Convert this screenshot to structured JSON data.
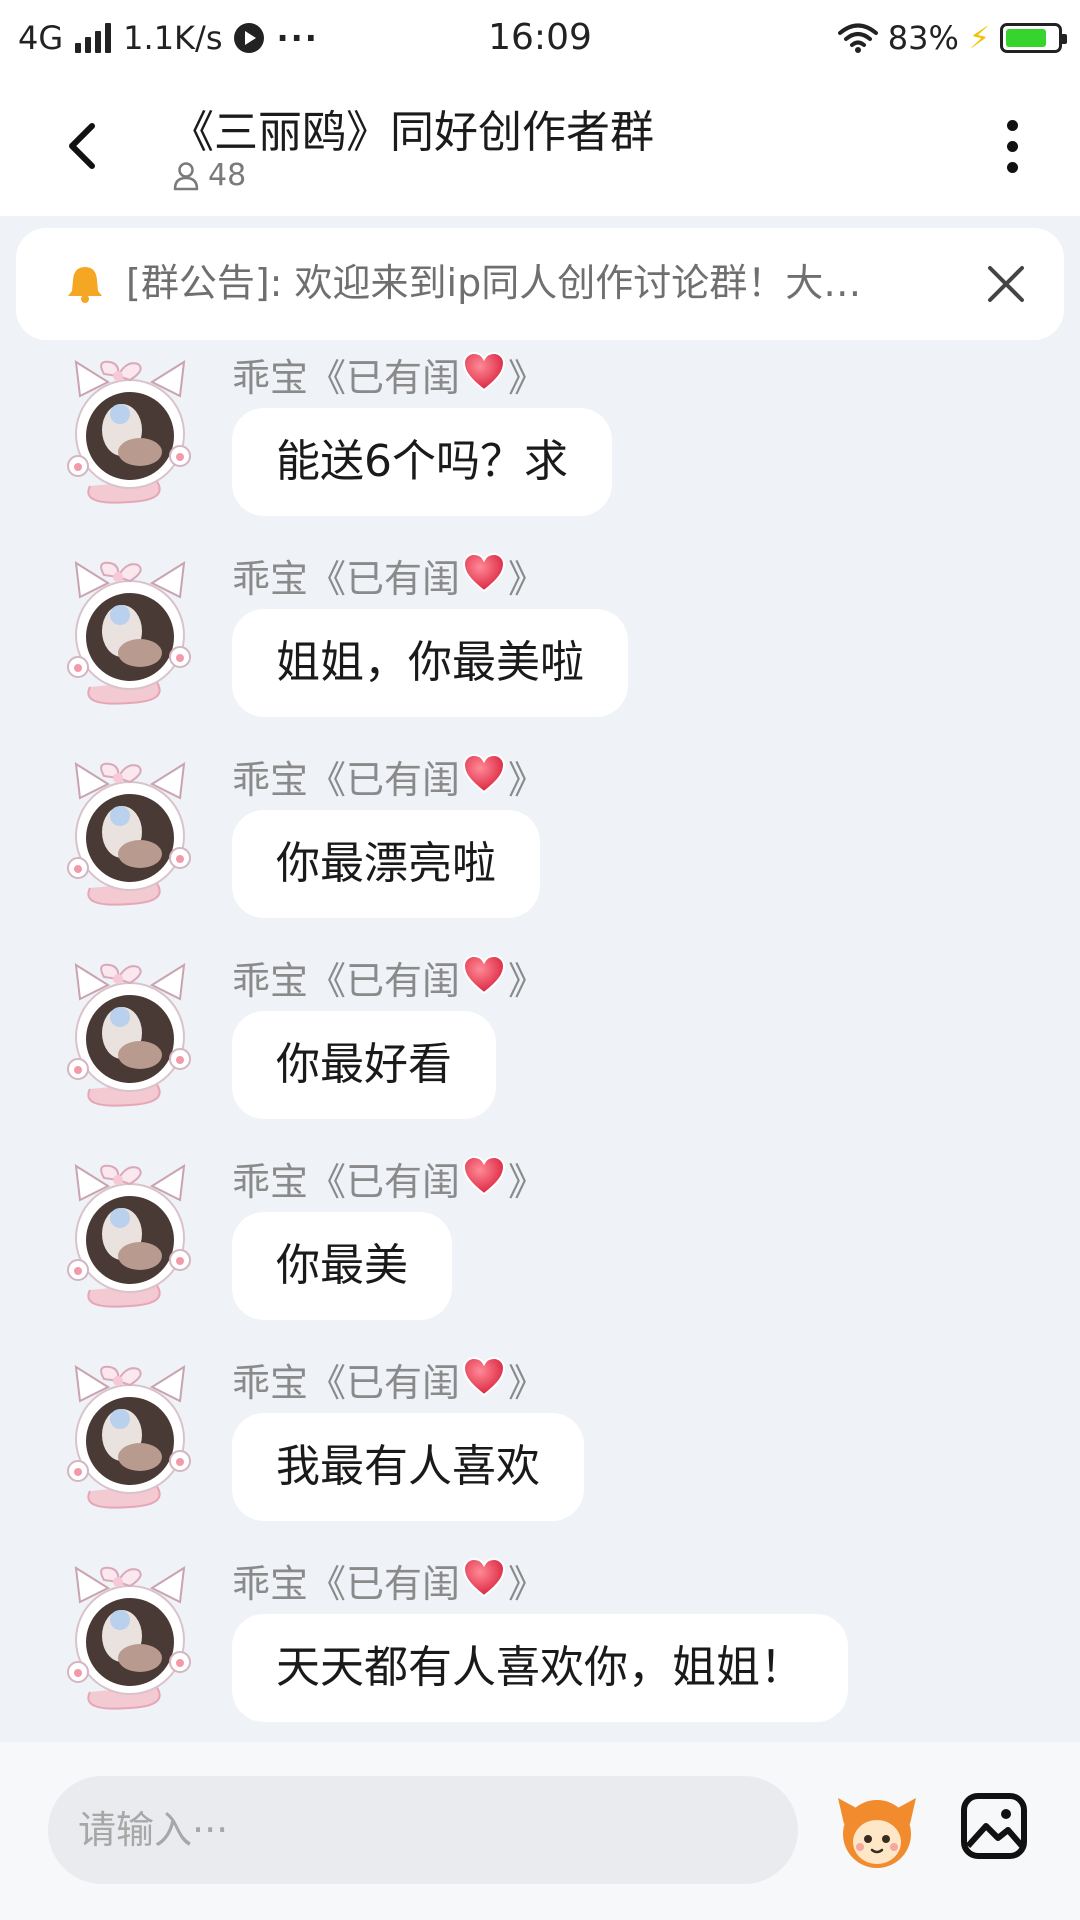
{
  "status_bar": {
    "network": "4G",
    "speed": "1.1K/s",
    "more": "···",
    "time": "16:09",
    "battery_percent": "83%",
    "battery_level": 0.83,
    "wifi_icon": "wifi-icon",
    "charging_icon": "charging-bolt-icon"
  },
  "header": {
    "title": "《三丽鸥》同好创作者群",
    "member_count": "48",
    "back_icon": "chevron-left-icon",
    "menu_icon": "more-vertical-icon"
  },
  "announcement": {
    "text": "[群公告]: 欢迎来到ip同人创作讨论群！大…",
    "icon": "bell-icon",
    "close_icon": "close-icon"
  },
  "messages": [
    {
      "sender": "乖宝《已有闺",
      "sender_suffix": "》",
      "text": "能送6个吗？求"
    },
    {
      "sender": "乖宝《已有闺",
      "sender_suffix": "》",
      "text": "姐姐，你最美啦"
    },
    {
      "sender": "乖宝《已有闺",
      "sender_suffix": "》",
      "text": "你最漂亮啦"
    },
    {
      "sender": "乖宝《已有闺",
      "sender_suffix": "》",
      "text": "你最好看"
    },
    {
      "sender": "乖宝《已有闺",
      "sender_suffix": "》",
      "text": "你最美"
    },
    {
      "sender": "乖宝《已有闺",
      "sender_suffix": "》",
      "text": "我最有人喜欢"
    },
    {
      "sender": "乖宝《已有闺",
      "sender_suffix": "》",
      "text": "天天都有人喜欢你，姐姐！"
    }
  ],
  "input": {
    "placeholder": "请输入···",
    "emoji_icon": "mascot-emoji-icon",
    "image_icon": "image-icon"
  },
  "colors": {
    "background": "#eff2f7",
    "bubble": "#ffffff",
    "battery_fill": "#37d42e",
    "bell": "#f5a623",
    "heart": "#e8334a"
  }
}
